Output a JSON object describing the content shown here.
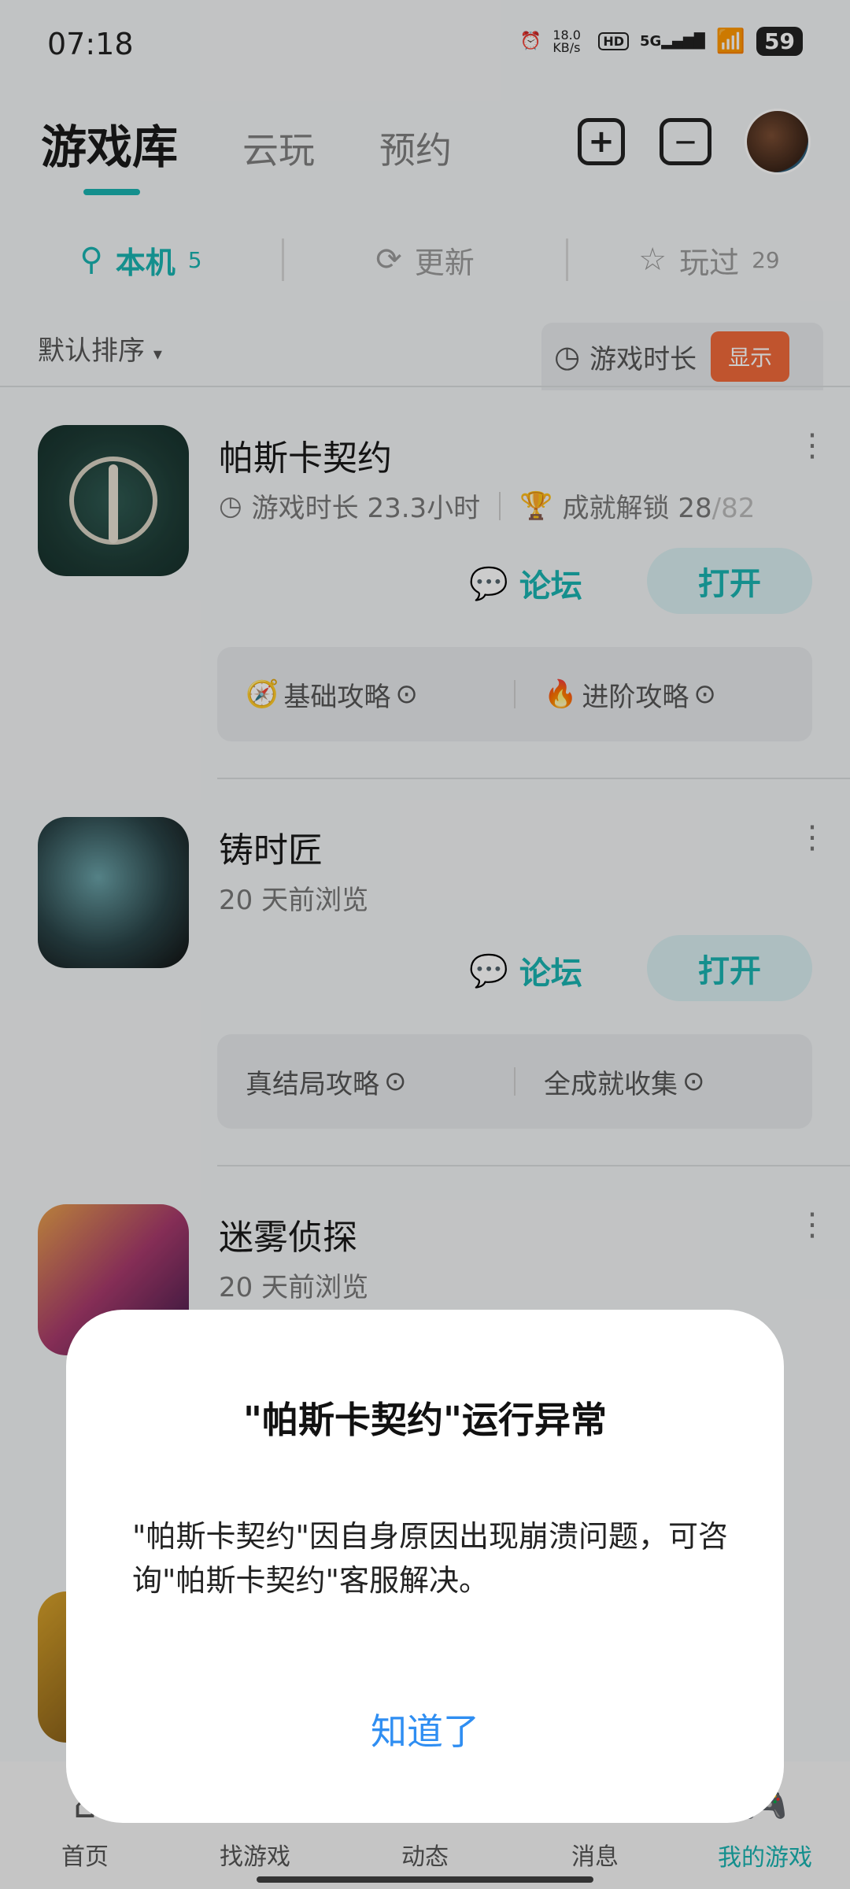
{
  "status_bar": {
    "time": "07:18",
    "net_speed": "18.0 KB/s",
    "hd": "HD",
    "signal": "5G",
    "battery": "59"
  },
  "header": {
    "tabs": [
      "游戏库",
      "云玩",
      "预约"
    ],
    "add_icon": "plus-square-icon",
    "toolbox_icon": "briefcase-icon"
  },
  "subtabs": [
    {
      "label": "本机",
      "count": "5",
      "icon": "pin-icon"
    },
    {
      "label": "更新",
      "count": "",
      "icon": "refresh-icon"
    },
    {
      "label": "玩过",
      "count": "29",
      "icon": "star-icon"
    }
  ],
  "sort": {
    "label": "默认排序"
  },
  "duration_toggle": {
    "label": "游戏时长",
    "button": "显示"
  },
  "games": [
    {
      "title": "帕斯卡契约",
      "meta1": "游戏时长 23.3小时",
      "meta2_prefix": "成就解锁 ",
      "meta2_done": "28",
      "meta2_total": "/82",
      "forum": "论坛",
      "open": "打开",
      "guides": [
        {
          "icon": "🧭",
          "label": "基础攻略"
        },
        {
          "icon": "🔥",
          "label": "进阶攻略"
        }
      ]
    },
    {
      "title": "铸时匠",
      "meta1": "20 天前浏览",
      "forum": "论坛",
      "open": "打开",
      "guides": [
        {
          "icon": "",
          "label": "真结局攻略"
        },
        {
          "icon": "",
          "label": "全成就收集"
        }
      ]
    },
    {
      "title": "迷雾侦探",
      "meta1": "20 天前浏览"
    }
  ],
  "bottom_nav": [
    {
      "label": "首页",
      "icon": "home-icon"
    },
    {
      "label": "找游戏",
      "icon": "search-game-icon"
    },
    {
      "label": "动态",
      "icon": "feed-icon"
    },
    {
      "label": "消息",
      "icon": "message-icon"
    },
    {
      "label": "我的游戏",
      "icon": "gamepad-icon"
    }
  ],
  "dialog": {
    "title": "\"帕斯卡契约\"运行异常",
    "body": "\"帕斯卡契约\"因自身原因出现崩溃问题，可咨询\"帕斯卡契约\"客服解决。",
    "button": "知道了"
  },
  "colors": {
    "accent": "#19b3b1",
    "orange": "#f06a3a",
    "dialog_button": "#2f8ef2"
  }
}
